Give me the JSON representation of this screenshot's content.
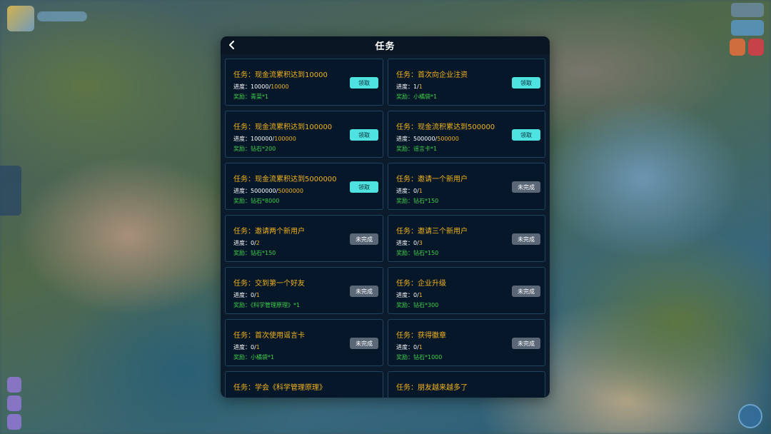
{
  "header": {
    "title": "任务"
  },
  "progress_prefix": "进度：",
  "tasks": [
    {
      "title": "任务：现金流累积达到10000",
      "current": "10000",
      "total": "10000",
      "reward": "奖励：青菜*1",
      "button": "领取",
      "status": "claim"
    },
    {
      "title": "任务：首次向企业注资",
      "current": "1",
      "total": "1",
      "reward": "奖励：小橘袋*1",
      "button": "领取",
      "status": "claim"
    },
    {
      "title": "任务：现金流累积达到100000",
      "current": "100000",
      "total": "100000",
      "reward": "奖励：钻石*200",
      "button": "领取",
      "status": "claim"
    },
    {
      "title": "任务：现金流积累达到500000",
      "current": "500000",
      "total": "500000",
      "reward": "奖励：谣言卡*1",
      "button": "领取",
      "status": "claim"
    },
    {
      "title": "任务：现金流累积达到5000000",
      "current": "5000000",
      "total": "5000000",
      "reward": "奖励：钻石*8000",
      "button": "领取",
      "status": "claim"
    },
    {
      "title": "任务：邀请一个新用户",
      "current": "0",
      "total": "1",
      "reward": "奖励：钻石*150",
      "button": "未完成",
      "status": "todo"
    },
    {
      "title": "任务：邀请两个新用户",
      "current": "0",
      "total": "2",
      "reward": "奖励：钻石*150",
      "button": "未完成",
      "status": "todo"
    },
    {
      "title": "任务：邀请三个新用户",
      "current": "0",
      "total": "3",
      "reward": "奖励：钻石*150",
      "button": "未完成",
      "status": "todo"
    },
    {
      "title": "任务：交到第一个好友",
      "current": "0",
      "total": "1",
      "reward": "奖励：《科学管理原理》*1",
      "button": "未完成",
      "status": "todo"
    },
    {
      "title": "任务：企业升级",
      "current": "0",
      "total": "1",
      "reward": "奖励：钻石*300",
      "button": "未完成",
      "status": "todo"
    },
    {
      "title": "任务：首次使用谣言卡",
      "current": "0",
      "total": "1",
      "reward": "奖励：小橘袋*1",
      "button": "未完成",
      "status": "todo"
    },
    {
      "title": "任务：获得徽章",
      "current": "0",
      "total": "1",
      "reward": "奖励：钻石*1000",
      "button": "未完成",
      "status": "todo"
    },
    {
      "title": "任务：学会《科学管理原理》",
      "current": "",
      "total": "",
      "reward": "",
      "button": "",
      "status": "todo"
    },
    {
      "title": "任务：朋友越来越多了",
      "current": "",
      "total": "",
      "reward": "",
      "button": "",
      "status": "todo"
    }
  ],
  "colors": {
    "panel": "#0c1b2c",
    "title_gold": "#f0b31c",
    "reward_green": "#3fd14a",
    "claim_cyan": "#4ee3e0",
    "todo_gray": "#5a6777"
  },
  "icons": {
    "back": "chevron-left-icon"
  }
}
